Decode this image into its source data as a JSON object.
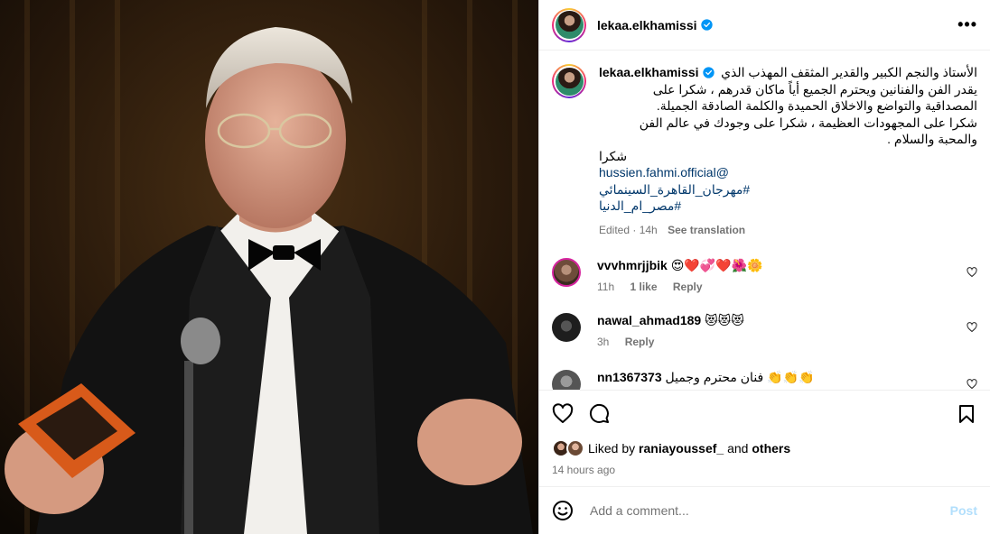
{
  "post": {
    "username": "lekaa.elkhamissi",
    "verified": true,
    "more_label": "•••"
  },
  "caption": {
    "username": "lekaa.elkhamissi",
    "lines": [
      "الأستاذ والنجم الكبير والقدير المثقف المهذب الذي",
      "يقدر الفن والفنانين ويحترم الجميع أياً ماكان قدرهم ، شكرا على",
      "المصداقية والتواضع والاخلاق الحميدة والكلمة الصادقة الجميلة.",
      "شكرا على المجهودات العظيمة ، شكرا على وجودك في عالم الفن",
      "والمحبة والسلام .",
      "شكرا"
    ],
    "mention": "hussien.fahmi.official@",
    "hashtags": [
      "#مهرجان_القاهرة_السينمائي",
      "#مصر_ام_الدنيا"
    ],
    "edited_label": "Edited",
    "edited_time": "14h",
    "see_translation": "See translation"
  },
  "comments": [
    {
      "username": "vvvhmrjjbik",
      "text": "😍❤️💞❤️🌺🌼",
      "time": "11h",
      "likes": "1 like",
      "reply": "Reply",
      "avatar_color": "#8a6a52"
    },
    {
      "username": "nawal_ahmad189",
      "text": "😻😻😻",
      "time": "3h",
      "likes": "",
      "reply": "Reply",
      "avatar_color": "#2a2a2a"
    },
    {
      "username": "nn1367373",
      "text": "فنان محترم وجميل 👏👏👏",
      "time": "",
      "likes": "",
      "reply": "",
      "avatar_color": "#6d6d6d"
    }
  ],
  "actions": {
    "liked_by_prefix": "Liked by",
    "liked_by_user": "raniayoussef_",
    "liked_by_and": "and",
    "liked_by_others": "others",
    "time_ago": "14 hours ago"
  },
  "add_comment": {
    "placeholder": "Add a comment...",
    "post_label": "Post"
  },
  "colors": {
    "link": "#00376b",
    "muted": "#737373",
    "verified": "#0095f6",
    "post_disabled": "#b2dffc"
  }
}
